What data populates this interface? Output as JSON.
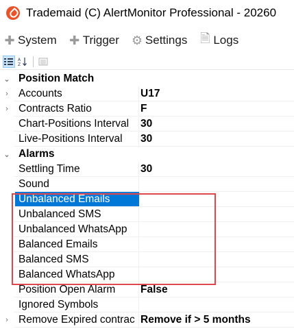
{
  "window": {
    "title": "Trademaid (C) AlertMonitor Professional - 20260"
  },
  "menu": [
    {
      "label": "System",
      "icon": "plus-icon",
      "glyph": "✚"
    },
    {
      "label": "Trigger",
      "icon": "plus-icon",
      "glyph": "✚"
    },
    {
      "label": "Settings",
      "icon": "gear-icon",
      "glyph": "⚙"
    },
    {
      "label": "Logs",
      "icon": "document-icon",
      "glyph": "🗎"
    }
  ],
  "toolbar": {
    "categorized_icon": "categorized-view-icon",
    "alphabetical_icon": "sort-alphabetical-icon",
    "property_pages_icon": "property-pages-icon"
  },
  "grid": {
    "categories": [
      {
        "label": "Position Match",
        "rows": [
          {
            "name": "Accounts",
            "value": "U17",
            "expander": true
          },
          {
            "name": "Contracts Ratio",
            "value": "F",
            "expander": true
          },
          {
            "name": "Chart-Positions Interval",
            "value": "30",
            "expander": false
          },
          {
            "name": "Live-Positions Interval",
            "value": "30",
            "expander": false
          }
        ]
      },
      {
        "label": "Alarms",
        "rows": [
          {
            "name": "Settling Time",
            "value": "30",
            "expander": false
          },
          {
            "name": "Sound",
            "value": "",
            "expander": false
          },
          {
            "name": "Unbalanced Emails",
            "value": "",
            "expander": false,
            "selected": true
          },
          {
            "name": "Unbalanced SMS",
            "value": "",
            "expander": false
          },
          {
            "name": "Unbalanced WhatsApp",
            "value": "",
            "expander": false
          },
          {
            "name": "Balanced Emails",
            "value": "",
            "expander": false
          },
          {
            "name": "Balanced SMS",
            "value": "",
            "expander": false
          },
          {
            "name": "Balanced WhatsApp",
            "value": "",
            "expander": false
          },
          {
            "name": "Position Open Alarm",
            "value": "False",
            "expander": false
          },
          {
            "name": "Ignored Symbols",
            "value": "",
            "expander": false
          },
          {
            "name": "Remove Expired contrac",
            "value": "Remove if > 5 months",
            "expander": true
          }
        ]
      }
    ]
  },
  "colors": {
    "accent": "#e5542b",
    "selection": "#0078d7",
    "highlight_border": "#e0474c"
  }
}
